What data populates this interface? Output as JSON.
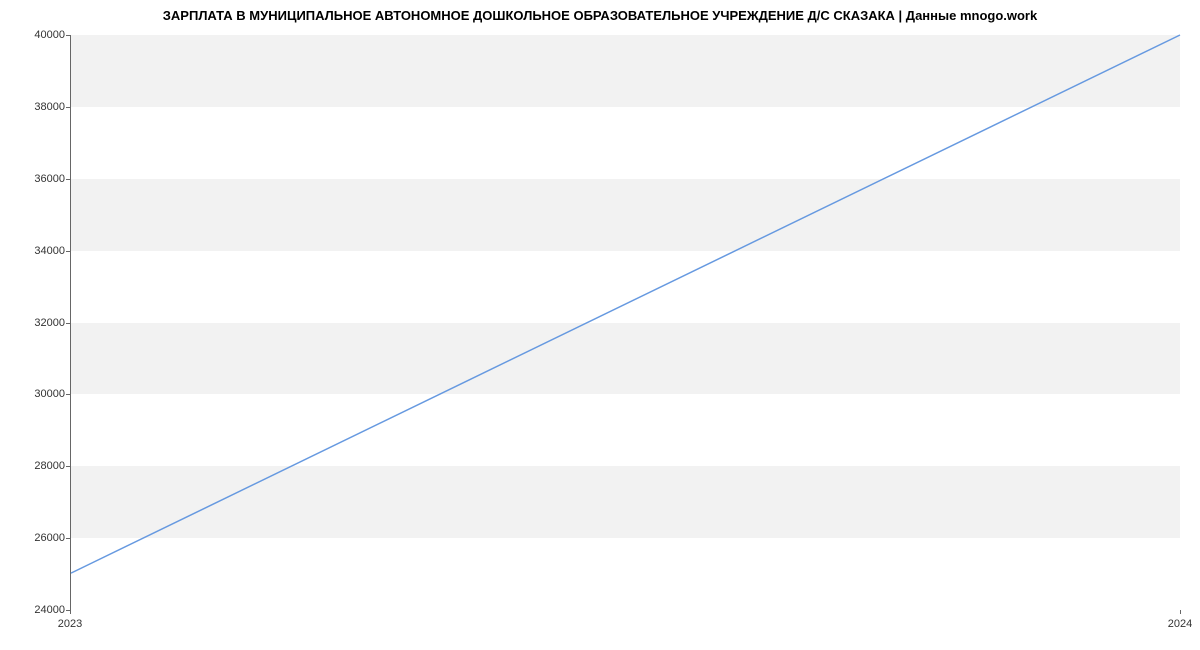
{
  "chart_data": {
    "type": "line",
    "title": "ЗАРПЛАТА В МУНИЦИПАЛЬНОЕ АВТОНОМНОЕ ДОШКОЛЬНОЕ ОБРАЗОВАТЕЛЬНОЕ УЧРЕЖДЕНИЕ Д/С СКАЗАКА | Данные mnogo.work",
    "x": [
      2023,
      2024
    ],
    "values": [
      25000,
      40000
    ],
    "xlabel": "",
    "ylabel": "",
    "ylim": [
      24000,
      40000
    ],
    "x_ticks": [
      2023,
      2024
    ],
    "y_ticks": [
      24000,
      26000,
      28000,
      30000,
      32000,
      34000,
      36000,
      38000,
      40000
    ],
    "line_color": "#6699e0"
  }
}
